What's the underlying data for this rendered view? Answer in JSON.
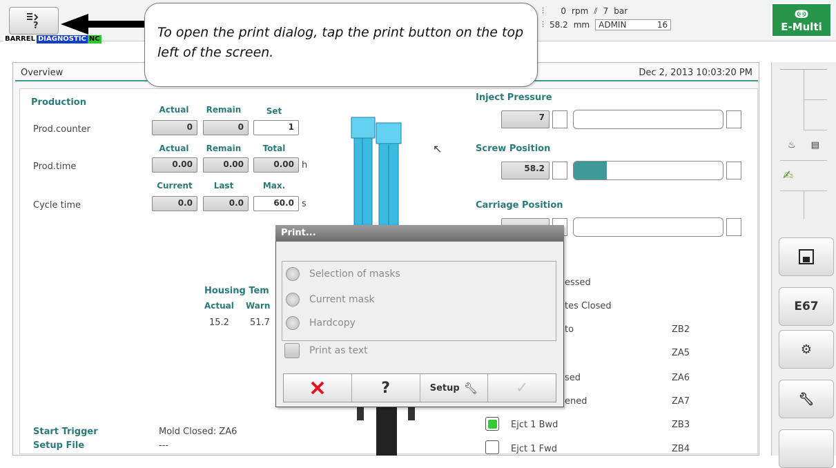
{
  "toolbar": {
    "status_barrel": "BARREL",
    "status_diag": "DIAGNOSTIC",
    "status_nc": "NC"
  },
  "header": {
    "rpm_value": "0",
    "rpm_unit": "rpm",
    "p_value": "7",
    "p_unit": "bar",
    "mm_value": "58.2",
    "mm_unit": "mm",
    "user": "ADMIN",
    "user_num": "16"
  },
  "logo": {
    "text": "E-Multi"
  },
  "callout": {
    "text": "To open the print dialog, tap the print button on the top left of the screen."
  },
  "panel": {
    "title": "Overview",
    "datetime": "Dec 2, 2013 10:03:20 PM"
  },
  "production": {
    "title": "Production",
    "counter_label": "Prod.counter",
    "counter_heads": [
      "Actual",
      "Remain",
      "Set"
    ],
    "counter_values": [
      "0",
      "0",
      "1"
    ],
    "time_label": "Prod.time",
    "time_heads": [
      "Actual",
      "Remain",
      "Total"
    ],
    "time_values": [
      "0.00",
      "0.00",
      "0.00"
    ],
    "time_unit": "h",
    "cycle_label": "Cycle time",
    "cycle_heads": [
      "Current",
      "Last",
      "Max."
    ],
    "cycle_values": [
      "0.0",
      "0.0",
      "60.0"
    ],
    "cycle_unit": "s"
  },
  "housing": {
    "title": "Housing Tem",
    "heads": [
      "Actual",
      "Warn"
    ],
    "values": [
      "15.2",
      "51.7"
    ]
  },
  "gauges": {
    "inject_title": "Inject Pressure",
    "inject_value": "7",
    "inject_fill": 0.0,
    "screw_title": "Screw Position",
    "screw_value": "58.2",
    "screw_fill": 0.22,
    "carriage_title": "Carriage Position"
  },
  "states": {
    "partial": [
      "essed",
      "tes Closed",
      "to",
      "",
      "sed",
      "ened"
    ],
    "codes": [
      "ZB2",
      "ZA5",
      "ZA6",
      "ZA7"
    ],
    "ejct_bwd": "Ejct 1 Bwd",
    "ejct_bwd_code": "ZB3",
    "ejct_fwd": "Ejct 1 Fwd",
    "ejct_fwd_code": "ZB4"
  },
  "footer": {
    "start_trigger_label": "Start Trigger",
    "start_trigger_value": "Mold Closed: ZA6",
    "setup_file_label": "Setup File",
    "setup_file_value": "---"
  },
  "dialog": {
    "title": "Print...",
    "options": [
      "Selection of masks",
      "Current mask",
      "Hardcopy"
    ],
    "print_as_text": "Print as text",
    "setup_label": "Setup",
    "help_label": "?"
  },
  "sidebar": {
    "e67_label": "E67"
  },
  "colors": {
    "accent": "#3a9a9a",
    "logo_green": "#27944a",
    "gauge_fill": "#3f9999",
    "diag_blue": "#1040c8",
    "nc_green": "#2ac82a",
    "cancel_red": "#e0141e",
    "indicator_green": "#33cc33"
  }
}
